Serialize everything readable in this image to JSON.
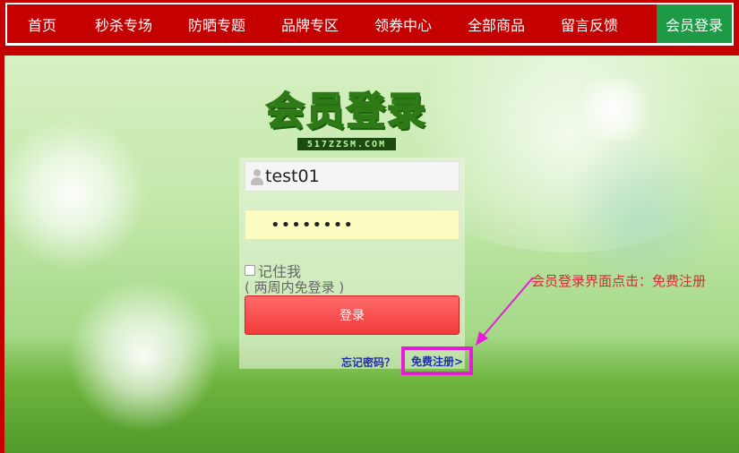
{
  "nav": {
    "items": [
      "首页",
      "秒杀专场",
      "防晒专题",
      "品牌专区",
      "领券中心",
      "全部商品",
      "留言反馈"
    ],
    "login_label": "会员登录"
  },
  "logo": {
    "title": "会员登录",
    "subtitle": "517ZZSM.COM"
  },
  "login_form": {
    "username_value": "test01",
    "password_value": "••••••••",
    "remember_label": "记住我",
    "remember_note": "( 两周内免登录 )",
    "submit_label": "登录",
    "forgot_label": "忘记密码？",
    "register_label": "免费注册>"
  },
  "annotation": {
    "text": "会员登录界面点击：免费注册"
  },
  "colors": {
    "nav_bg": "#c40000",
    "login_tab_bg": "#1e9a47",
    "button_red": "#f23a3a",
    "highlight_magenta": "#e61cd8",
    "annotation_red": "#e0263a",
    "link_blue": "#1f2ea8"
  }
}
